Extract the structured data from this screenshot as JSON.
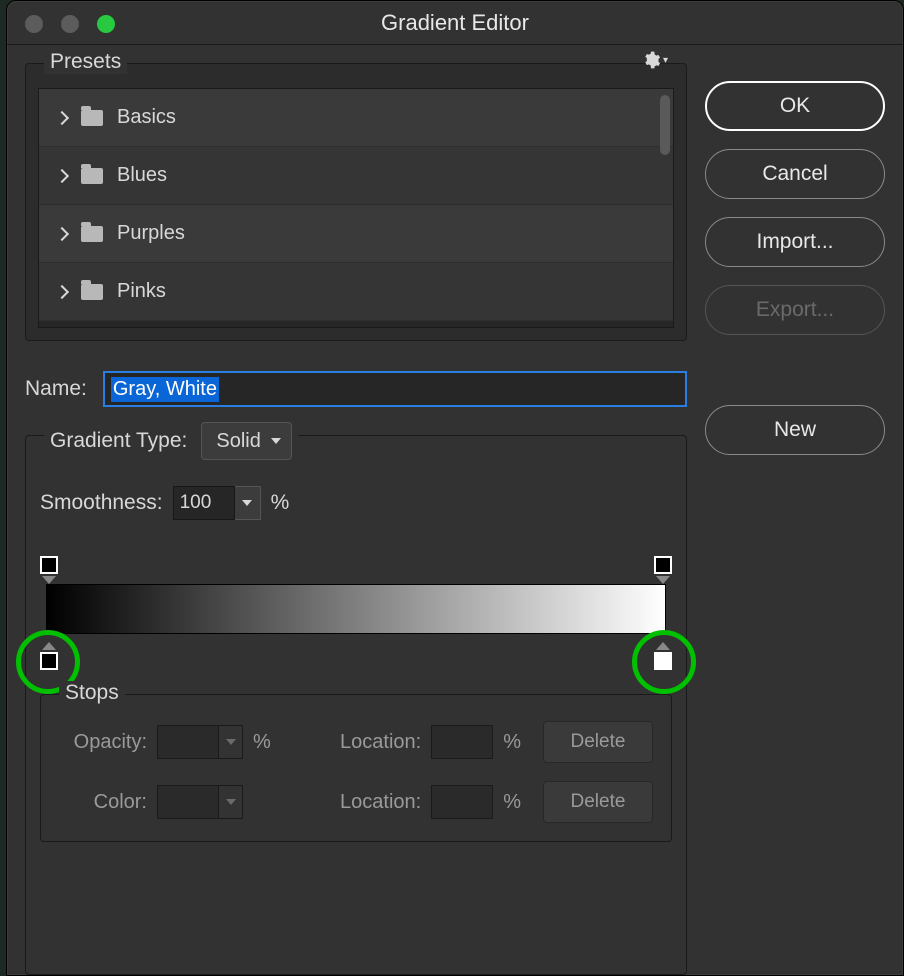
{
  "window": {
    "title": "Gradient Editor"
  },
  "presets": {
    "label": "Presets",
    "items": [
      {
        "label": "Basics"
      },
      {
        "label": "Blues"
      },
      {
        "label": "Purples"
      },
      {
        "label": "Pinks"
      }
    ]
  },
  "buttons": {
    "ok": "OK",
    "cancel": "Cancel",
    "import": "Import...",
    "export": "Export...",
    "new": "New"
  },
  "name": {
    "label": "Name:",
    "value": "Gray, White"
  },
  "gradient": {
    "type_label": "Gradient Type:",
    "type_value": "Solid",
    "smoothness_label": "Smoothness:",
    "smoothness_value": "100",
    "percent": "%"
  },
  "stops": {
    "label": "Stops",
    "opacity_label": "Opacity:",
    "opacity_value": "",
    "color_label": "Color:",
    "location_label": "Location:",
    "location1_value": "",
    "location2_value": "",
    "delete": "Delete",
    "percent": "%"
  }
}
